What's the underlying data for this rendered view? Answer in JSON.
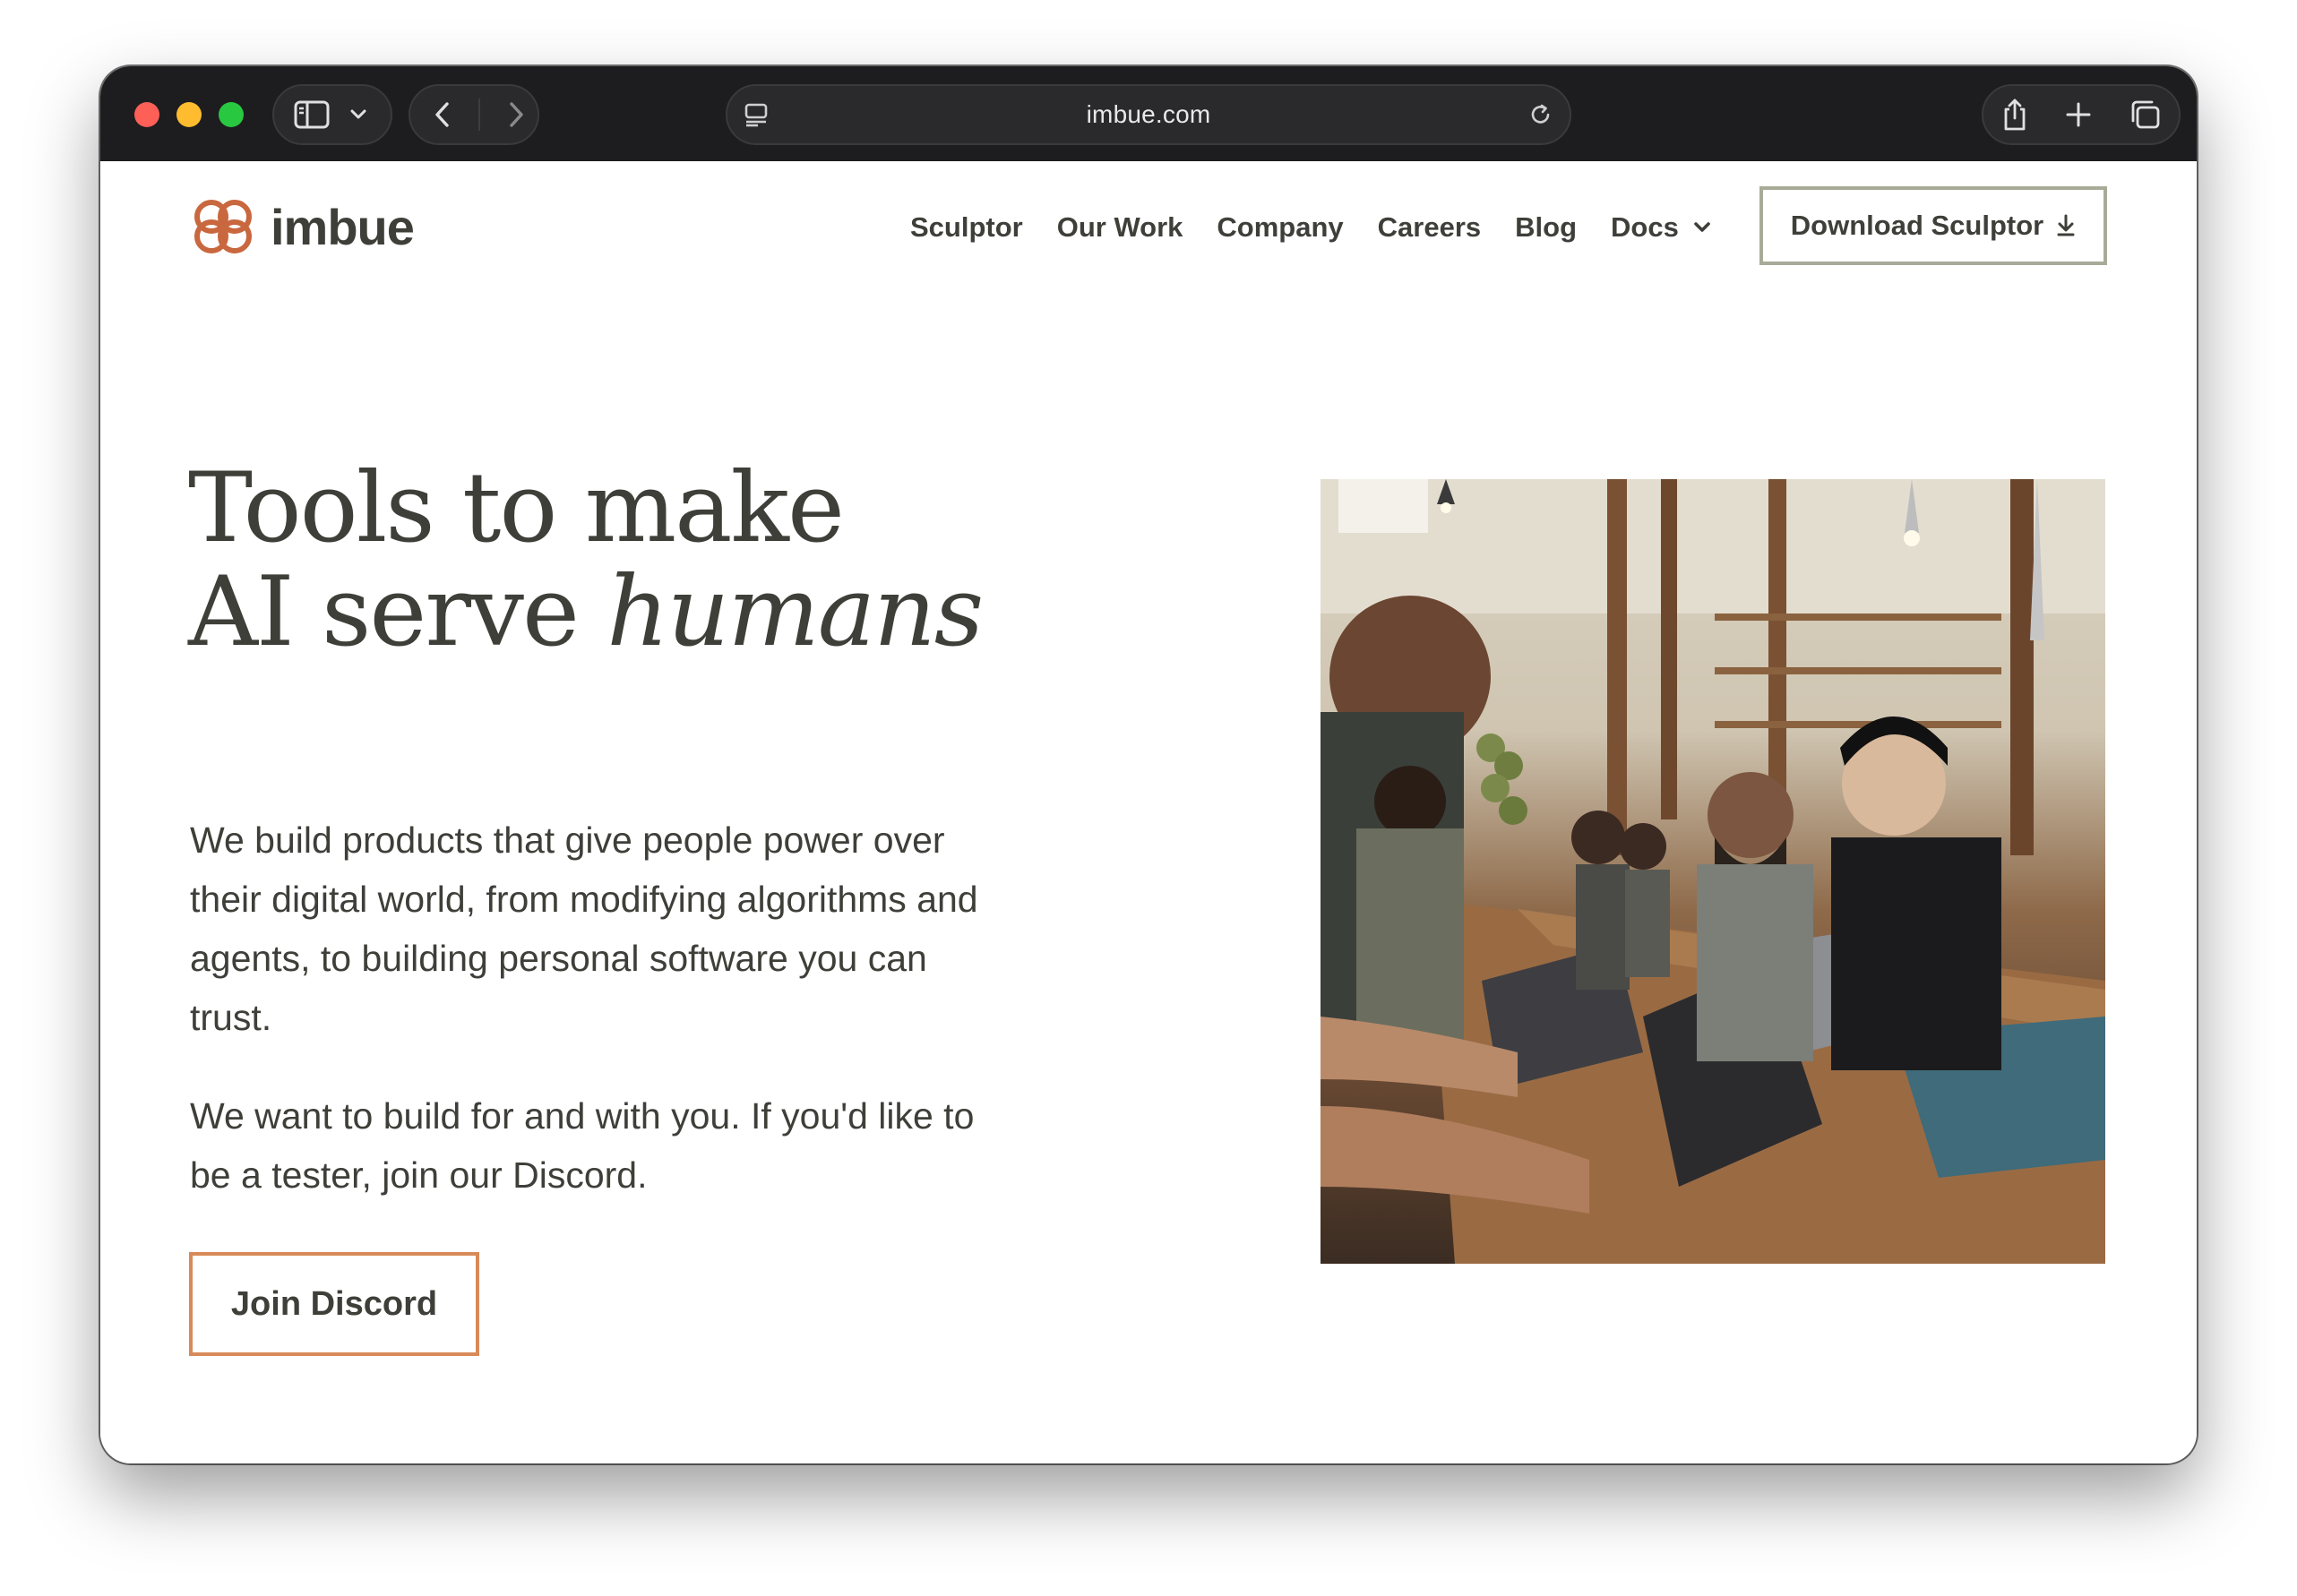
{
  "browser": {
    "url": "imbue.com",
    "icons": {
      "sidebar": "sidebar-icon",
      "sidebar_menu": "chevron-down-icon",
      "back": "back-arrow-icon",
      "forward": "forward-arrow-icon",
      "site": "site-info-icon",
      "reload": "reload-icon",
      "share": "share-icon",
      "new_tab": "plus-icon",
      "tabs": "tab-overview-icon"
    },
    "colors": {
      "close": "#fe5f57",
      "minimize": "#febc2e",
      "zoom": "#28c840"
    }
  },
  "site": {
    "brand": "imbue",
    "nav": {
      "items": [
        "Sculptor",
        "Our Work",
        "Company",
        "Careers",
        "Blog",
        "Docs"
      ],
      "download_label": "Download Sculptor"
    },
    "hero": {
      "title_line1": "Tools to make",
      "title_line2_plain": "AI serve ",
      "title_line2_italic": "humans",
      "paragraph1": "We build products that give people power over their digital world, from modifying algorithms and agents, to building personal software you can trust.",
      "paragraph2": "We want to build for and with you. If you'd like to be a tester, join our Discord.",
      "cta_label": "Join Discord",
      "photo_alt": "team-photo"
    },
    "colors": {
      "text": "#3f3f3a",
      "accent": "#d88a58",
      "download_border": "#a8ab98",
      "logo": "#c9673f"
    }
  }
}
